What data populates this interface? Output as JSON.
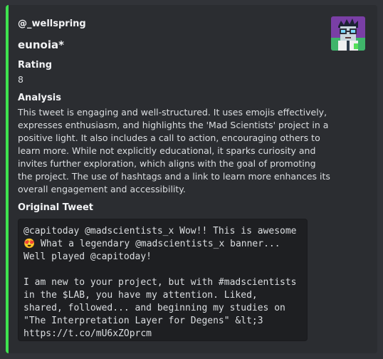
{
  "embed": {
    "accent_color": "#3ee24f",
    "author": "@_wellspring",
    "title": "eunoia*",
    "thumbnail_icon": "mad-scientist-avatar-icon"
  },
  "fields": {
    "rating": {
      "name": "Rating",
      "value": "8"
    },
    "analysis": {
      "name": "Analysis",
      "value": "This tweet is engaging and well-structured. It uses emojis effectively, expresses enthusiasm, and highlights the 'Mad Scientists' project in a positive light. It also includes a call to action, encouraging others to learn more. While not explicitly educational, it sparks curiosity and invites further exploration, which aligns with the goal of promoting the project. The use of hashtags and a link to learn more enhances its overall engagement and accessibility."
    },
    "original_tweet": {
      "name": "Original Tweet",
      "value": "@capitoday @madscientists_x Wow!! This is awesome 😍 What a legendary @madscientists_x banner... Well played @capitoday!\n\nI am new to your project, but with #madscientists in the $LAB, you have my attention. Liked, shared, followed... and beginning my studies on \"The Interpretation Layer for Degens\" &lt;3 https://t.co/mU6xZOprcm"
    }
  }
}
